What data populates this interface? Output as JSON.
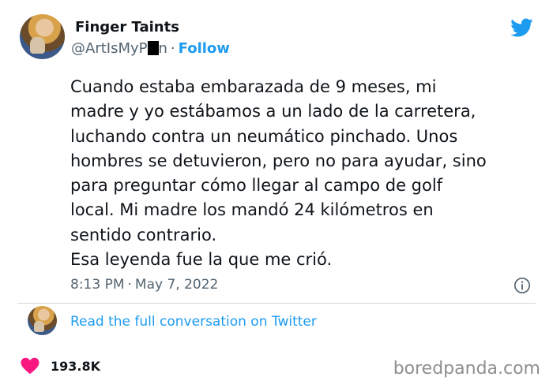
{
  "user": {
    "name": "Finger Taints",
    "handle_prefix": "@ArtIsMyP",
    "handle_suffix": "n",
    "separator": "·",
    "follow_label": "Follow"
  },
  "tweet": {
    "lines": [
      "Cuando estaba embarazada de 9 meses, mi",
      "madre y yo estábamos a un lado de la carretera,",
      "luchando contra un neumático pinchado. Unos",
      "hombres se detuvieron, pero no para ayudar, sino",
      "para preguntar cómo llegar al campo de golf",
      "local. Mi madre los mandó 24 kilómetros en",
      "sentido contrario.",
      "Esa leyenda fue la que me crió."
    ],
    "time": "8:13 PM",
    "separator": "·",
    "date": "May 7, 2022"
  },
  "conversation": {
    "link_label": "Read the full conversation on Twitter"
  },
  "engagement": {
    "likes": "193.8K"
  },
  "watermark": "boredpanda.com",
  "icons": {
    "brand": "twitter-bird-icon",
    "info": "info-icon",
    "like": "heart-icon"
  },
  "colors": {
    "accent": "#1d9bf0",
    "heart": "#f91880",
    "muted": "#536471",
    "text": "#0f1419"
  }
}
